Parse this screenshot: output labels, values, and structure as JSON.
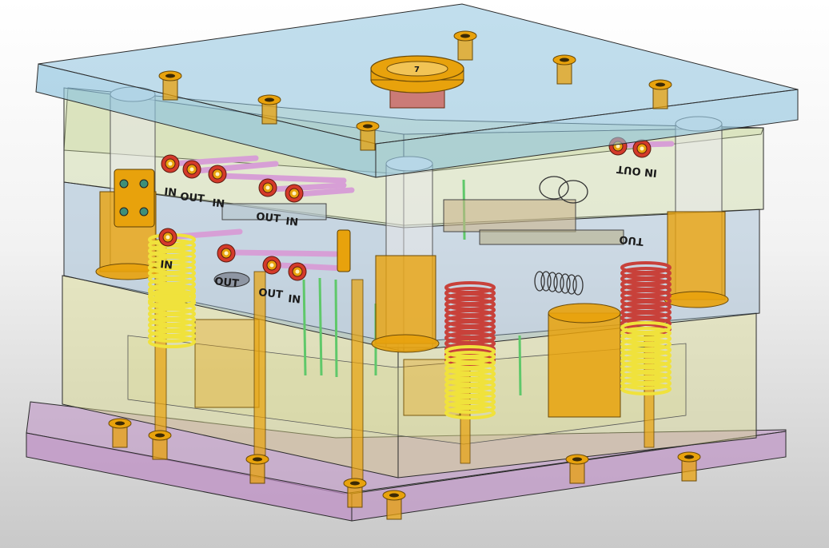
{
  "view": {
    "background_top": "#ffffff",
    "background_bottom": "#c8c8c8"
  },
  "colors": {
    "top_clamp_plate": "#8ec3de",
    "cavity_plate": "#c9d79a",
    "core_plate": "#93b4cf",
    "spacer_block": "#d9d98a",
    "bottom_clamp_plate": "#bd8fc4",
    "brass": "#e8a20c",
    "red_fitting": "#d43a2a",
    "spring_yellow": "#f0e23c",
    "spring_red": "#c8413a",
    "hose_pink": "#d79fd6",
    "pin_green": "#5fc86a",
    "edge_line": "#2b2b2b"
  },
  "coolant_labels": [
    {
      "text": "IN"
    },
    {
      "text": "OUT"
    },
    {
      "text": "IN"
    },
    {
      "text": "OUT"
    },
    {
      "text": "IN"
    },
    {
      "text": "IN"
    },
    {
      "text": "OUT"
    },
    {
      "text": "OUT"
    },
    {
      "text": "IN"
    },
    {
      "text": "IN OUT"
    },
    {
      "text": "TUO"
    }
  ],
  "sprue_bushing_mark": "7"
}
